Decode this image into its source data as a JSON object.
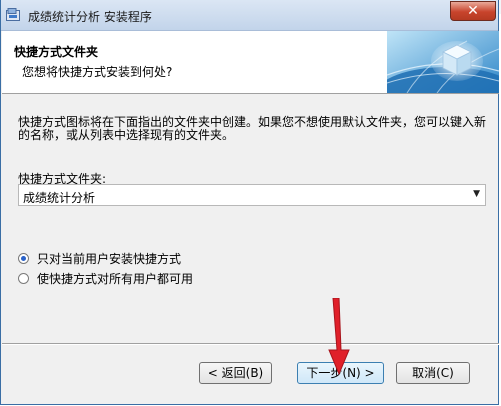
{
  "window": {
    "title": "成绩统计分析 安装程序",
    "close_label": "✕"
  },
  "header": {
    "title": "快捷方式文件夹",
    "subtitle": "您想将快捷方式安装到何处?"
  },
  "content": {
    "description": "快捷方式图标将在下面指出的文件夹中创建。如果您不想使用默认文件夹，您可以键入新的名称，或从列表中选择现有的文件夹。",
    "folder_label": "快捷方式文件夹:",
    "folder_value": "成绩统计分析",
    "options": [
      {
        "label": "只对当前用户安装快捷方式",
        "checked": true
      },
      {
        "label": "使快捷方式对所有用户都可用",
        "checked": false
      }
    ]
  },
  "buttons": {
    "back": "< 返回(B)",
    "next": "下一步(N) >",
    "cancel": "取消(C)"
  },
  "colors": {
    "accent": "#2a62c9",
    "close": "#c8442c",
    "cursor": "#e0202a"
  },
  "icons": {
    "app": "installer-icon",
    "header_art": "globe-cube-icon",
    "dropdown": "chevron-down-icon",
    "pointer": "red-arrow-cursor-icon"
  }
}
